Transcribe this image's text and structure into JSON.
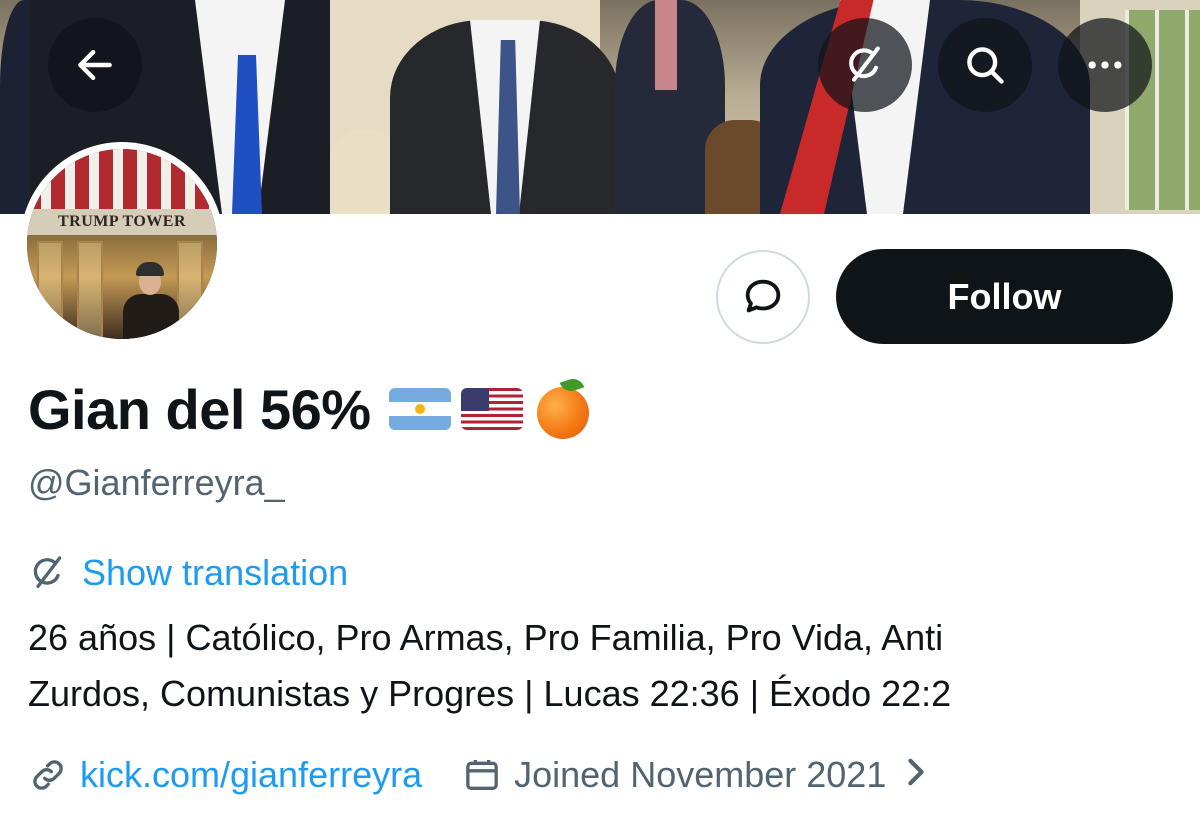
{
  "profile": {
    "display_name": "Gian del 56%",
    "name_emoji": [
      "argentina-flag",
      "usa-flag",
      "tangerine"
    ],
    "handle": "@Gianferreyra_",
    "show_translation": "Show translation",
    "bio_line1": "26 años | Católico, Pro Armas, Pro Familia, Pro Vida, Anti",
    "bio_line2": "Zurdos, Comunistas y Progres | Lucas 22:36 | Éxodo 22:2",
    "link": "kick.com/gianferreyra",
    "joined": "Joined November 2021",
    "avatar_sign": "TRUMP TOWER"
  },
  "actions": {
    "follow_label": "Follow"
  },
  "header_icons": [
    "back-arrow-icon",
    "grok-icon",
    "search-icon",
    "more-icon"
  ],
  "colors": {
    "accent": "#1d9bf0",
    "text": "#0f1419",
    "secondary": "#536471",
    "follow_bg": "#0f1419"
  }
}
